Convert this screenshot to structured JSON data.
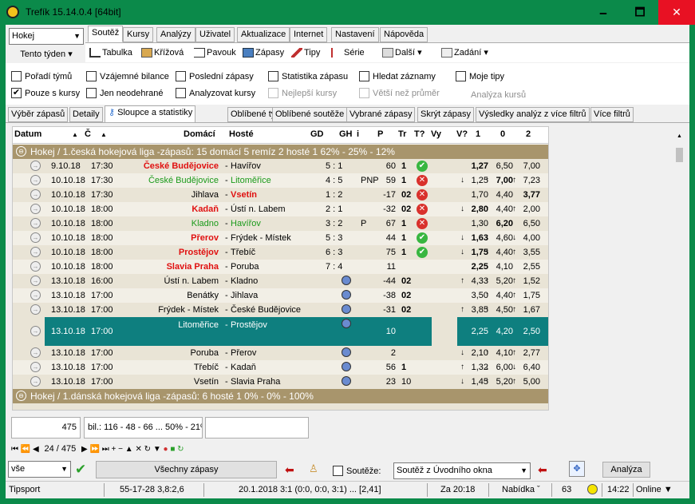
{
  "window": {
    "title": "Trefík 15.14.0.4 [64bit]",
    "min": "🗕",
    "max": "🗖",
    "close": "✕"
  },
  "sport": "Hokej",
  "period": "Tento týden",
  "tabs": [
    "Soutěž",
    "Kursy",
    "Analýzy",
    "Uživatel",
    "Aktualizace",
    "Internet",
    "Nastavení",
    "Nápověda"
  ],
  "toolbar": [
    "Tabulka",
    "Křížová",
    "Pavouk",
    "Zápasy",
    "Tipy",
    "Série",
    "Další",
    "Zadání"
  ],
  "checks": [
    {
      "label": "Pořadí týmů",
      "checked": false
    },
    {
      "label": "Vzájemné bilance",
      "checked": false
    },
    {
      "label": "Poslední zápasy",
      "checked": false
    },
    {
      "label": "Statistika zápasu",
      "checked": false
    },
    {
      "label": "Hledat záznamy",
      "checked": false
    },
    {
      "label": "Moje tipy",
      "checked": false
    },
    {
      "label": "Pouze s kursy",
      "checked": true
    },
    {
      "label": "Jen neodehrané",
      "checked": false
    },
    {
      "label": "Analyzovat kursy",
      "checked": false
    },
    {
      "label": "Nejlepší kursy",
      "checked": false
    },
    {
      "label": "Větší než průměr",
      "checked": false
    },
    {
      "label": "Analýza kursů",
      "checked": false
    }
  ],
  "check_mark": "✔",
  "subtabs": [
    "Výběr zápasů",
    "Detaily",
    "Sloupce a statistiky",
    "Oblíbené týmy",
    "Oblíbené soutěže",
    "Vybrané zápasy",
    "Skrýt zápasy",
    "Výsledky analýz z více filtrů",
    "Více filtrů"
  ],
  "columns": [
    "Datum",
    "Č",
    "Domácí",
    "Hosté",
    "GD",
    "GH",
    "i",
    "P",
    "Tr",
    "T?",
    "Vy",
    "V?",
    "1",
    "0",
    "2"
  ],
  "group1": "Hokej / 1.česká hokejová liga        -zápasů: 15  domácí 5  remíz 2  hosté 1      62% - 25% - 12%",
  "group2": "Hokej / 1.dánská hokejová liga        -zápasů: 6    hosté 1      0% - 0% - 100%",
  "rows": [
    {
      "d": "9.10.18",
      "t": "17:30",
      "h": "České Budějovice",
      "hs": "red",
      "a": "Havířov",
      "as": "",
      "s": "5 : 1",
      "i": "",
      "p": "60",
      "tr": "1",
      "res": "ok",
      "o1": "1,27",
      "o0": "6,50",
      "o2": "7,00",
      "b1": true,
      "a1": "",
      "a0": "",
      "a2": ""
    },
    {
      "d": "10.10.18",
      "t": "17:30",
      "h": "České Budějovice",
      "hs": "grn",
      "a": "Litoměřice",
      "as": "grn",
      "s": "4 : 5",
      "i": "PNP",
      "p": "59",
      "tr": "1",
      "res": "bad",
      "o1": "1,25",
      "o0": "7,00",
      "o2": "7,23",
      "b0": true,
      "a1": "↓",
      "a0": "↑",
      "a2": "↑"
    },
    {
      "d": "10.10.18",
      "t": "17:30",
      "h": "Jihlava",
      "hs": "",
      "a": "Vsetín",
      "as": "red",
      "s": "1 : 2",
      "i": "",
      "p": "-17",
      "tr": "02",
      "res": "bad",
      "o1": "1,70",
      "o0": "4,40",
      "o2": "3,77",
      "b2": true,
      "a1": "",
      "a0": "",
      "a2": ""
    },
    {
      "d": "10.10.18",
      "t": "18:00",
      "h": "Kadaň",
      "hs": "red",
      "a": "Ústí n. Labem",
      "as": "",
      "s": "2 : 1",
      "i": "",
      "p": "-32",
      "tr": "02",
      "res": "bad",
      "o1": "2,80",
      "o0": "4,40",
      "o2": "2,00",
      "b1": true,
      "a1": "↓",
      "a0": "↑",
      "a2": "↑"
    },
    {
      "d": "10.10.18",
      "t": "18:00",
      "h": "Kladno",
      "hs": "grn",
      "a": "Havířov",
      "as": "grn",
      "s": "3 : 2",
      "i": "P",
      "p": "67",
      "tr": "1",
      "res": "bad",
      "o1": "1,30",
      "o0": "6,20",
      "o2": "6,50",
      "b0": true,
      "a1": "",
      "a0": "",
      "a2": ""
    },
    {
      "d": "10.10.18",
      "t": "18:00",
      "h": "Přerov",
      "hs": "red",
      "a": "Frýdek - Místek",
      "as": "",
      "s": "5 : 3",
      "i": "",
      "p": "44",
      "tr": "1",
      "res": "ok",
      "o1": "1,63",
      "o0": "4,60",
      "o2": "4,00",
      "b1": true,
      "a1": "↓",
      "a0": "↓",
      "a2": "↓"
    },
    {
      "d": "10.10.18",
      "t": "18:00",
      "h": "Prostějov",
      "hs": "red",
      "a": "Třebíč",
      "as": "",
      "s": "6 : 3",
      "i": "",
      "p": "75",
      "tr": "1",
      "res": "ok",
      "o1": "1,75",
      "o0": "4,40",
      "o2": "3,55",
      "b1": true,
      "a1": "↓",
      "a0": "↑",
      "a2": "↑"
    },
    {
      "d": "10.10.18",
      "t": "18:00",
      "h": "Slavia Praha",
      "hs": "red",
      "a": "Poruba",
      "as": "",
      "s": "7 : 4",
      "i": "",
      "p": "11",
      "tr": "",
      "res": "",
      "o1": "2,25",
      "o0": "4,10",
      "o2": "2,55",
      "b1": true,
      "a1": "",
      "a0": "",
      "a2": ""
    },
    {
      "d": "13.10.18",
      "t": "16:00",
      "h": "Ústí n. Labem",
      "hs": "",
      "a": "Kladno",
      "as": "",
      "s": "",
      "i": "",
      "p": "-44",
      "tr": "02",
      "res": "",
      "o1": "4,33",
      "o0": "5,20",
      "o2": "1,52",
      "gh": true,
      "a1": "↑",
      "a0": "↑",
      "a2": "↑"
    },
    {
      "d": "13.10.18",
      "t": "17:00",
      "h": "Benátky",
      "hs": "",
      "a": "Jihlava",
      "as": "",
      "s": "",
      "i": "",
      "p": "-38",
      "tr": "02",
      "res": "",
      "o1": "3,50",
      "o0": "4,40",
      "o2": "1,75",
      "gh": true,
      "a1": "",
      "a0": "↑",
      "a2": "↑"
    },
    {
      "d": "13.10.18",
      "t": "17:00",
      "h": "Frýdek - Místek",
      "hs": "",
      "a": "České Budějovice",
      "as": "",
      "s": "",
      "i": "",
      "p": "-31",
      "tr": "02",
      "res": "",
      "o1": "3,85",
      "o0": "4,50",
      "o2": "1,67",
      "gh": true,
      "a1": "↑",
      "a0": "↑",
      "a2": "↑"
    },
    {
      "d": "13.10.18",
      "t": "17:00",
      "h": "Litoměřice",
      "hs": "",
      "a": "Prostějov",
      "as": "",
      "s": "",
      "i": "",
      "p": "10",
      "tr": "",
      "res": "",
      "o1": "2,25",
      "o0": "4,20",
      "o2": "2,50",
      "gh": true,
      "sel": true,
      "a1": "",
      "a0": "",
      "a2": ""
    },
    {
      "d": "13.10.18",
      "t": "17:00",
      "h": "Poruba",
      "hs": "",
      "a": "Přerov",
      "as": "",
      "s": "",
      "i": "",
      "p": "2",
      "tr": "",
      "res": "",
      "o1": "2,10",
      "o0": "4,10",
      "o2": "2,77",
      "gh": true,
      "a1": "↓",
      "a0": "↑",
      "a2": "↑"
    },
    {
      "d": "13.10.18",
      "t": "17:00",
      "h": "Třebíč",
      "hs": "",
      "a": "Kadaň",
      "as": "",
      "s": "",
      "i": "",
      "p": "56",
      "tr": "1",
      "res": "",
      "o1": "1,32",
      "o0": "6,00",
      "o2": "6,40",
      "gh": true,
      "a1": "↑",
      "a0": "↓",
      "a2": "↓"
    },
    {
      "d": "13.10.18",
      "t": "17:00",
      "h": "Vsetín",
      "hs": "",
      "a": "Slavia Praha",
      "as": "",
      "s": "",
      "i": "",
      "p": "23",
      "tr": "10",
      "res": "",
      "o1": "1,45",
      "o0": "5,20",
      "o2": "5,00",
      "gh": true,
      "a1": "↓",
      "a0": "↑",
      "a2": "↑"
    }
  ],
  "pagecount": "475",
  "stats": "bil.: 116 - 48 - 66 ... 50% - 21% - 2",
  "nav": "24 / 475",
  "bottom": {
    "filter": "vše",
    "matches_btn": "Všechny zápasy",
    "comp_label": "Soutěže:",
    "comp_value": "Soutěž z Úvodního okna",
    "analyze_btn": "Analýza"
  },
  "status": [
    "Tipsport",
    "55-17-28  3,8:2,6",
    "20.1.2018 3:1 (0:0, 0:0, 3:1) ... [2,41]",
    "Za 20:18",
    "Nabídka ˇ",
    "63",
    "14:22",
    "Online ▼"
  ]
}
